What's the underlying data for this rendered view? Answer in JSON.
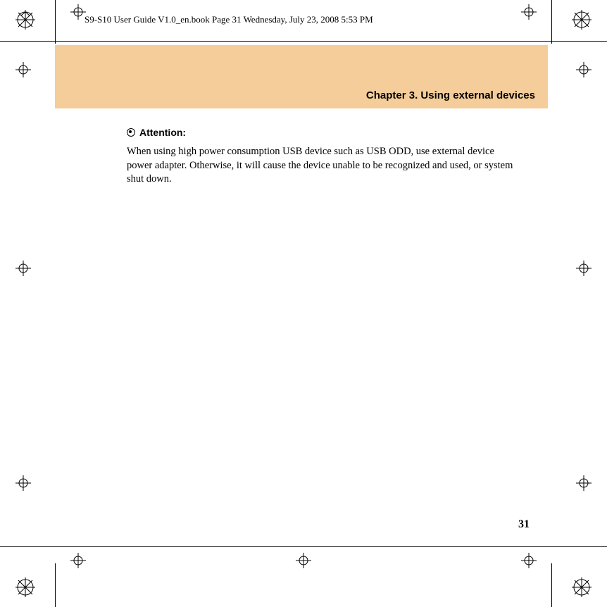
{
  "header": {
    "info": "S9-S10 User Guide V1.0_en.book  Page 31  Wednesday, July 23, 2008  5:53 PM"
  },
  "chapter": {
    "title": "Chapter 3. Using external devices"
  },
  "attention": {
    "label": "Attention:",
    "body": "When using high power consumption USB device such as USB ODD, use external device power adapter. Otherwise, it will cause the device unable to be recognized and used, or system shut down."
  },
  "page_number": "31",
  "colors": {
    "banner": "#f5cd9a"
  }
}
